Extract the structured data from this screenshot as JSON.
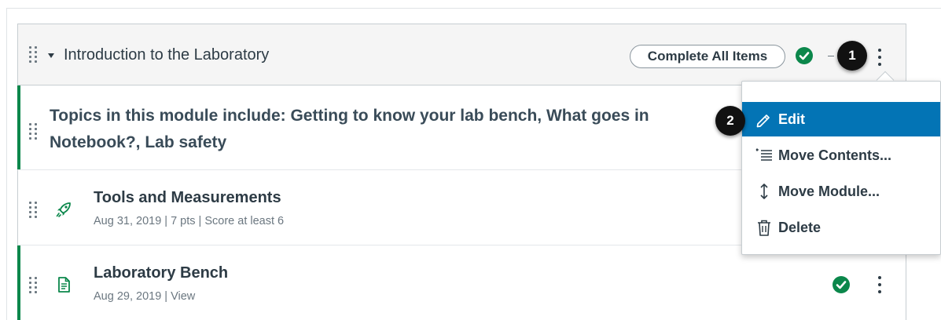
{
  "module": {
    "title": "Introduction to the Laboratory",
    "complete_all_label": "Complete All Items",
    "subheader": "Topics in this module include: Getting to know your lab bench, What goes in Notebook?, Lab safety",
    "items": [
      {
        "title": "Tools and Measurements",
        "meta": "Aug 31, 2019  |  7 pts  |  Score at least 6",
        "icon": "rocket-icon"
      },
      {
        "title": "Laboratory Bench",
        "meta": "Aug 29, 2019  |  View",
        "icon": "page-icon"
      }
    ]
  },
  "menu": {
    "items": [
      {
        "label": "Edit",
        "icon": "pencil-icon",
        "active": true
      },
      {
        "label": "Move Contents...",
        "icon": "move-contents-icon",
        "active": false
      },
      {
        "label": "Move Module...",
        "icon": "move-vertical-icon",
        "active": false
      },
      {
        "label": "Delete",
        "icon": "trash-icon",
        "active": false
      }
    ]
  },
  "callouts": {
    "first": "1",
    "second": "2"
  },
  "colors": {
    "accent": "#0374b5",
    "success": "#0b874b",
    "text": "#2d3b45",
    "muted": "#6b7780"
  }
}
